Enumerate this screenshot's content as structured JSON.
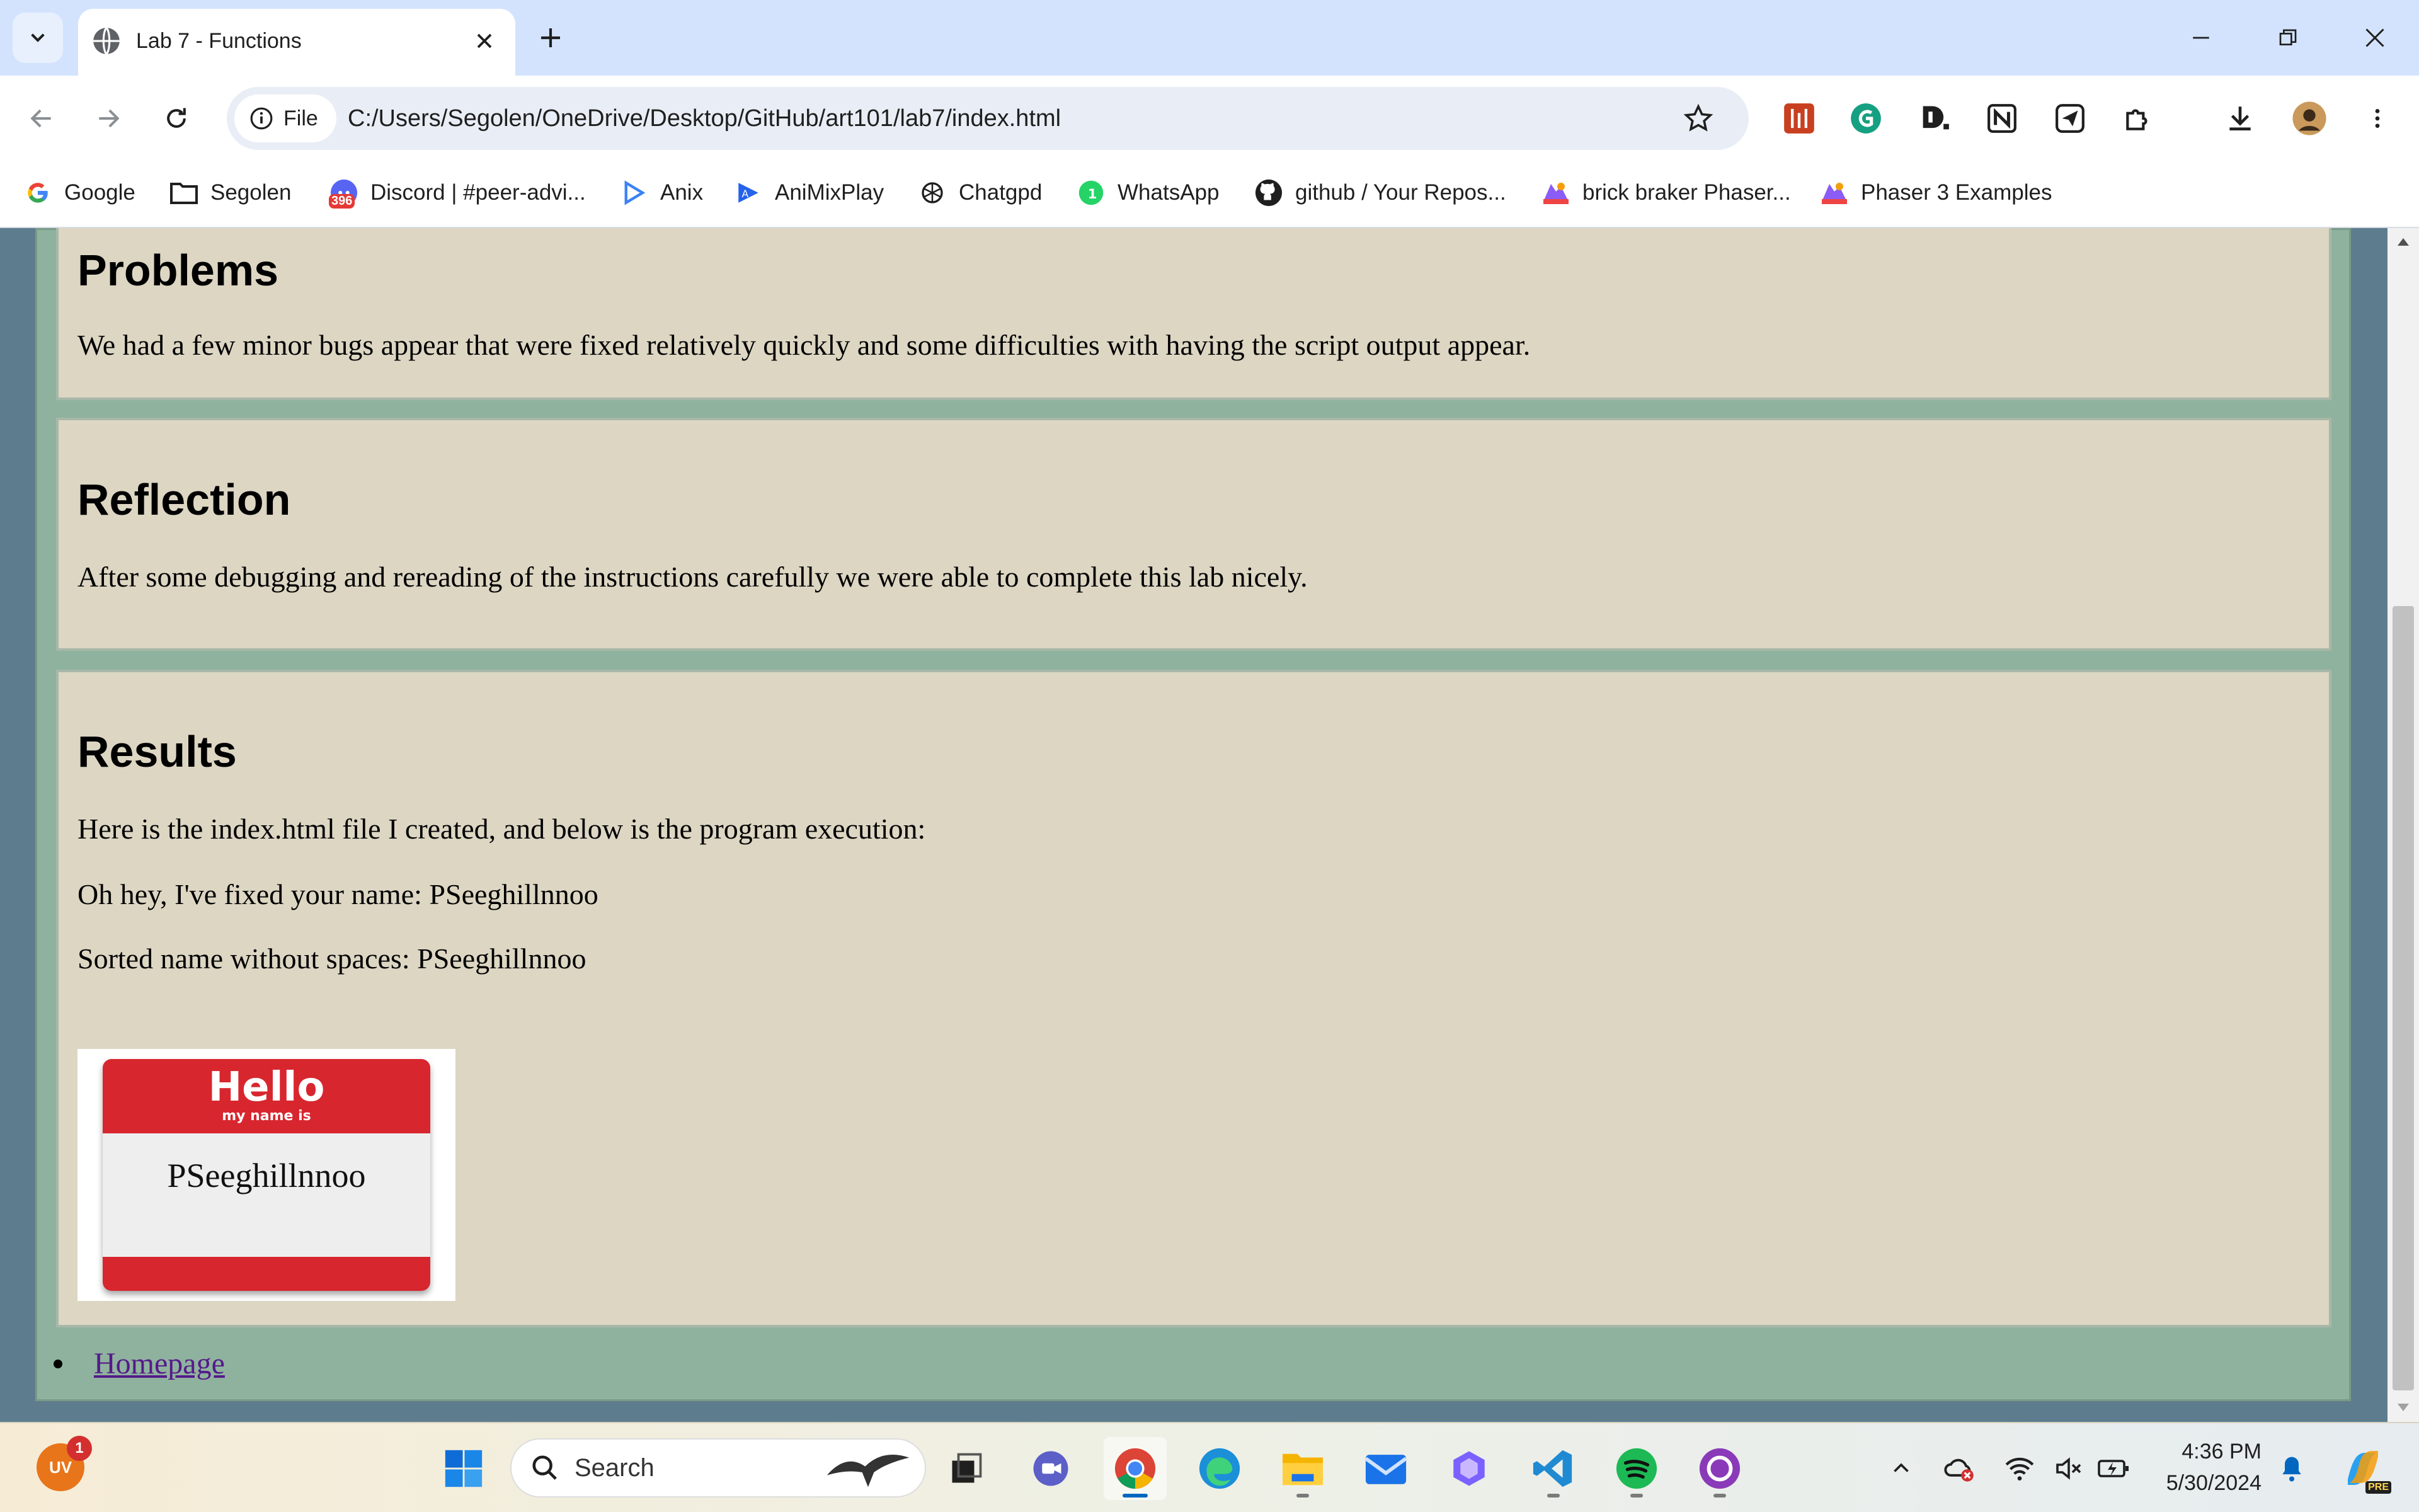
{
  "browser": {
    "tab_title": "Lab 7 - Functions",
    "site_info_label": "File",
    "url": "C:/Users/Segolen/OneDrive/Desktop/GitHub/art101/lab7/index.html",
    "bookmarks": [
      {
        "label": "Google",
        "icon": "google-icon"
      },
      {
        "label": "Segolen",
        "icon": "folder-icon"
      },
      {
        "label": "Discord | #peer-advi...",
        "icon": "discord-icon",
        "badge": "396"
      },
      {
        "label": "Anix",
        "icon": "play-icon"
      },
      {
        "label": "AniMixPlay",
        "icon": "animix-icon"
      },
      {
        "label": "Chatgpd",
        "icon": "openai-icon"
      },
      {
        "label": "WhatsApp",
        "icon": "whatsapp-icon",
        "badge": "1"
      },
      {
        "label": "github / Your Repos...",
        "icon": "github-icon"
      },
      {
        "label": "brick braker Phaser...",
        "icon": "phaser-icon"
      },
      {
        "label": "Phaser 3 Examples",
        "icon": "phaser-icon"
      }
    ]
  },
  "page": {
    "problems": {
      "heading": "Problems",
      "text": "We had a few minor bugs appear that were fixed relatively quickly and some difficulties with having the script output appear."
    },
    "reflection": {
      "heading": "Reflection",
      "text": "After some debugging and rereading of the instructions carefully we were able to complete this lab nicely."
    },
    "results": {
      "heading": "Results",
      "intro": "Here is the index.html file I created, and below is the program execution:",
      "fixed_name": "Oh hey, I've fixed your name: PSeeghillnnoo",
      "sorted_name": "Sorted name without spaces: PSeeghillnnoo",
      "nametag": {
        "hello": "Hello",
        "my_name_is": "my name is",
        "name": "PSeeghillnnoo"
      }
    },
    "homepage_link": "Homepage"
  },
  "taskbar": {
    "search_placeholder": "Search",
    "avatar_initials": "UV",
    "notification_count": "1",
    "time": "4:36 PM",
    "date": "5/30/2024",
    "copilot_badge": "PRE"
  },
  "colors": {
    "page_background": "#5d7d8e",
    "wrapper_background": "#8fb29e",
    "card_background": "#dcd6c3",
    "link_color": "#551a8b",
    "tabstrip": "#d3e3fd"
  }
}
